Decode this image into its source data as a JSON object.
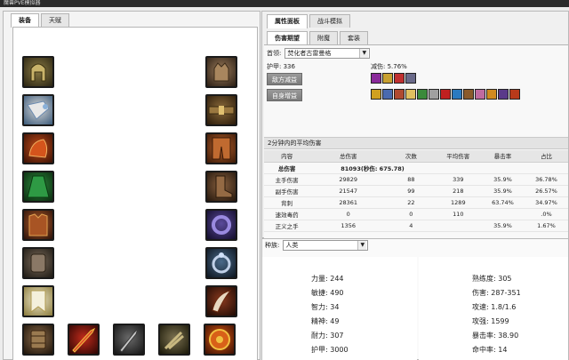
{
  "window": {
    "title": "魔兽PVE模拟器"
  },
  "left_tabs": [
    "装备",
    "天赋"
  ],
  "right_tabs": [
    "属性面板",
    "战斗模拟"
  ],
  "sub_tabs": [
    "伤害期望",
    "附魔",
    "套装"
  ],
  "target": {
    "label": "首领:",
    "value": "焚化者古雷曼格"
  },
  "armor": "护甲: 336",
  "reduction": "减伤: 5.76%",
  "enemy_debuff_btn": "敌方减益",
  "self_buff_btn": "自身增益",
  "damage_section_title": "2分钟内的平均伤害",
  "damage_table": {
    "headers": [
      "内容",
      "总伤害",
      "次数",
      "平均伤害",
      "暴击率",
      "占比"
    ],
    "rows": [
      [
        "总伤害",
        "81093(秒伤: 675.78)",
        "",
        "",
        "",
        ""
      ],
      [
        "主手伤害",
        "29829",
        "88",
        "339",
        "35.9%",
        "36.78%"
      ],
      [
        "副手伤害",
        "21547",
        "99",
        "218",
        "35.9%",
        "26.57%"
      ],
      [
        "背刺",
        "28361",
        "22",
        "1289",
        "63.74%",
        "34.97%"
      ],
      [
        "速效毒药",
        "0",
        "0",
        "110",
        "",
        ".0%"
      ],
      [
        "正义之手",
        "1356",
        "4",
        "",
        "35.9%",
        "1.67%"
      ]
    ]
  },
  "race": {
    "label": "种族:",
    "value": "人类"
  },
  "stats_left": [
    {
      "label": "力量:",
      "value": "244"
    },
    {
      "label": "敏捷:",
      "value": "490"
    },
    {
      "label": "智力:",
      "value": "34"
    },
    {
      "label": "精神:",
      "value": "49"
    },
    {
      "label": "耐力:",
      "value": "307"
    },
    {
      "label": "护甲:",
      "value": "3000"
    }
  ],
  "stats_right": [
    {
      "label": "熟练度:",
      "value": "305"
    },
    {
      "label": "伤害:",
      "value": "287-351"
    },
    {
      "label": "攻速:",
      "value": "1.8/1.6"
    },
    {
      "label": "攻强:",
      "value": "1599"
    },
    {
      "label": "暴击率:",
      "value": "38.90"
    },
    {
      "label": "命中率:",
      "value": "14"
    }
  ],
  "slot_icons": [
    "helmet-icon",
    "neck-icon",
    "shoulder-icon",
    "cloak-icon",
    "chest-icon",
    "bracer-icon",
    "tabard-icon",
    "gloves-icon",
    "belt-icon",
    "legs-icon",
    "boots-icon",
    "ring-1-icon",
    "ring-2-icon",
    "trinket-icon",
    "trinket-2-icon",
    "main-hand-icon",
    "off-hand-icon",
    "thrown-icon",
    "bag-icon"
  ]
}
